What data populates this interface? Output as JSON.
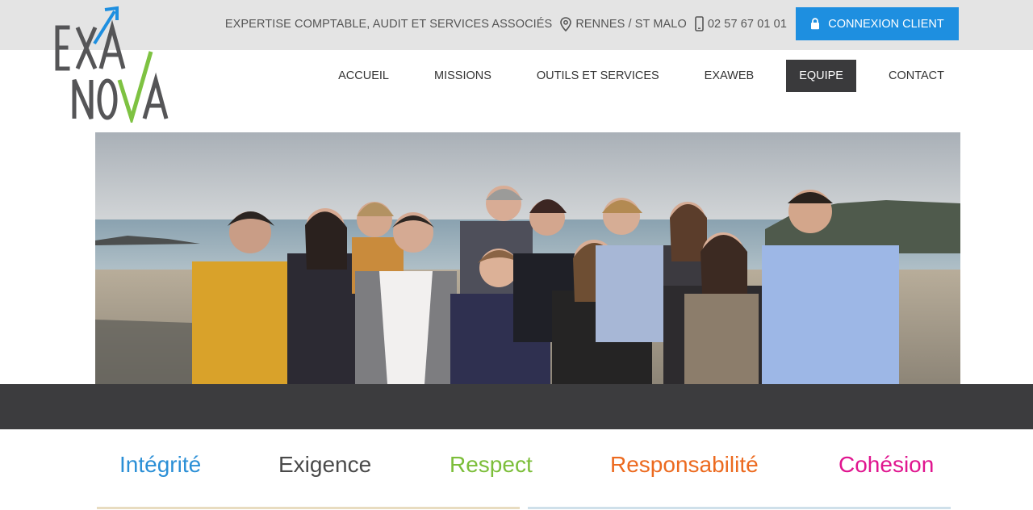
{
  "topbar": {
    "tagline": "EXPERTISE COMPTABLE, AUDIT ET SERVICES ASSOCIÉS",
    "location": "RENNES / ST MALO",
    "location_icon": "map-pin-icon",
    "phone": "02 57 67 01 01",
    "phone_icon": "mobile-phone-icon",
    "login_label": "CONNEXION CLIENT",
    "login_icon": "lock-icon",
    "login_color": "#1e8fe0"
  },
  "logo": {
    "line1": "EXA",
    "line2": "NOVA",
    "arrow_color": "#1e8fe0",
    "check_color": "#7ec242"
  },
  "nav": {
    "items": [
      {
        "label": "ACCUEIL",
        "active": false
      },
      {
        "label": "MISSIONS",
        "active": false
      },
      {
        "label": "OUTILS ET SERVICES",
        "active": false
      },
      {
        "label": "EXAWEB",
        "active": false
      },
      {
        "label": "EQUIPE",
        "active": true
      },
      {
        "label": "CONTACT",
        "active": false
      }
    ]
  },
  "values": [
    {
      "label": "Intégrité",
      "color": "#2b8fd6"
    },
    {
      "label": "Exigence",
      "color": "#4a4a4a"
    },
    {
      "label": "Respect",
      "color": "#7cbe3a"
    },
    {
      "label": "Responsabilité",
      "color": "#ec6a1f"
    },
    {
      "label": "Cohésion",
      "color": "#e0158f"
    }
  ]
}
